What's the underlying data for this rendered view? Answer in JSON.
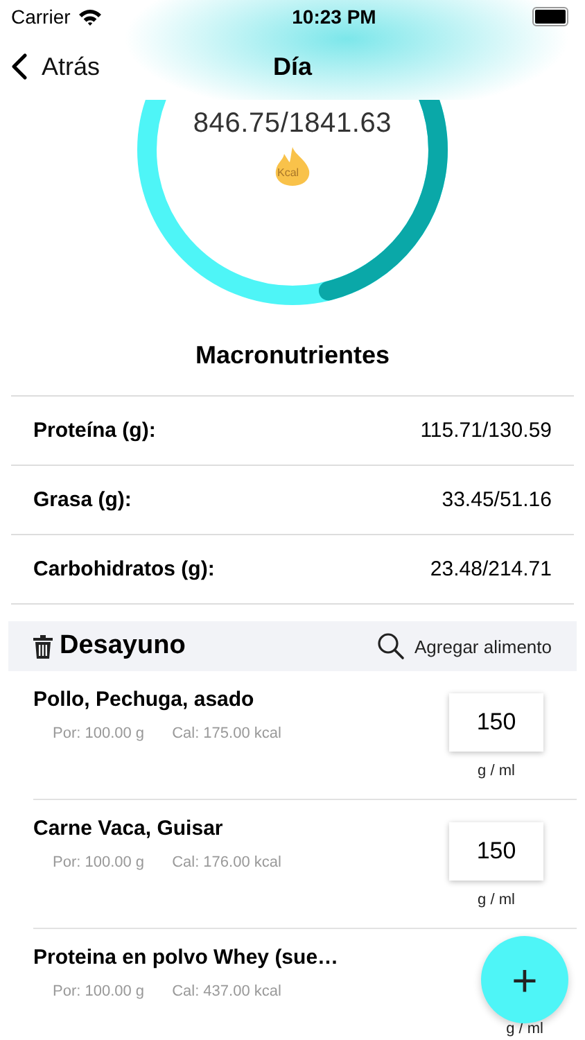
{
  "status_bar": {
    "carrier": "Carrier",
    "time": "10:23 PM"
  },
  "nav": {
    "back": "Atrás",
    "title": "Día"
  },
  "calories": {
    "reading": "846.75/1841.63",
    "unit": "Kcal",
    "level": 0.46
  },
  "macros": {
    "title": "Macronutrientes",
    "rows": [
      {
        "label": "Proteína (g):",
        "value": "115.71/130.59"
      },
      {
        "label": "Grasa (g):",
        "value": "33.45/51.16"
      },
      {
        "label": "Carbohidratos (g):",
        "value": "23.48/214.71"
      }
    ]
  },
  "meal": {
    "title": "Desayuno",
    "add": "Agregar alimento",
    "foods": [
      {
        "name": "Pollo, Pechuga, asado",
        "portion": "Por: 100.00 g",
        "cal": "Cal: 175.00 kcal",
        "amount": "150",
        "unit": "g / ml"
      },
      {
        "name": "Carne Vaca, Guisar",
        "portion": "Por: 100.00 g",
        "cal": "Cal: 176.00 kcal",
        "amount": "150",
        "unit": "g / ml"
      },
      {
        "name": "Proteina en polvo Whey (sue…",
        "portion": "Por: 100.00 g",
        "cal": "Cal: 437.00 kcal",
        "unit": "g / ml"
      }
    ]
  },
  "fab": {
    "label": "+"
  }
}
